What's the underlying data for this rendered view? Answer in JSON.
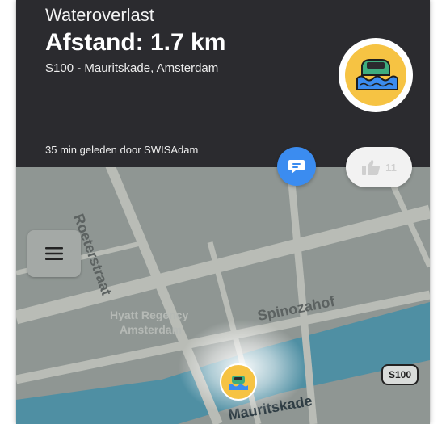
{
  "alert": {
    "type": "Wateroverlast",
    "distance": "Afstand: 1.7 km",
    "location": "S100 - Mauritskade, Amsterdam",
    "reported": "35 min geleden door SWISAdam",
    "icon": "flooded-car-icon"
  },
  "actions": {
    "comment_icon": "chat-bubble-icon",
    "like_icon": "thumbs-up-icon",
    "like_count": "11"
  },
  "menu": {
    "icon": "hamburger-menu-icon"
  },
  "map": {
    "labels": {
      "roeterstraat": "Roeterstraat",
      "spinozahof": "Spinozahof",
      "hyatt_line1": "Hyatt Regency",
      "hyatt_line2": "Amsterdam",
      "mauritskade": "Mauritskade"
    },
    "road_shield": "S100",
    "colors": {
      "water": "#4f8fa3",
      "road": "#b9bcb6",
      "block": "#8f9693",
      "pin": "#f6c343",
      "comment": "#3b8cf0"
    }
  }
}
